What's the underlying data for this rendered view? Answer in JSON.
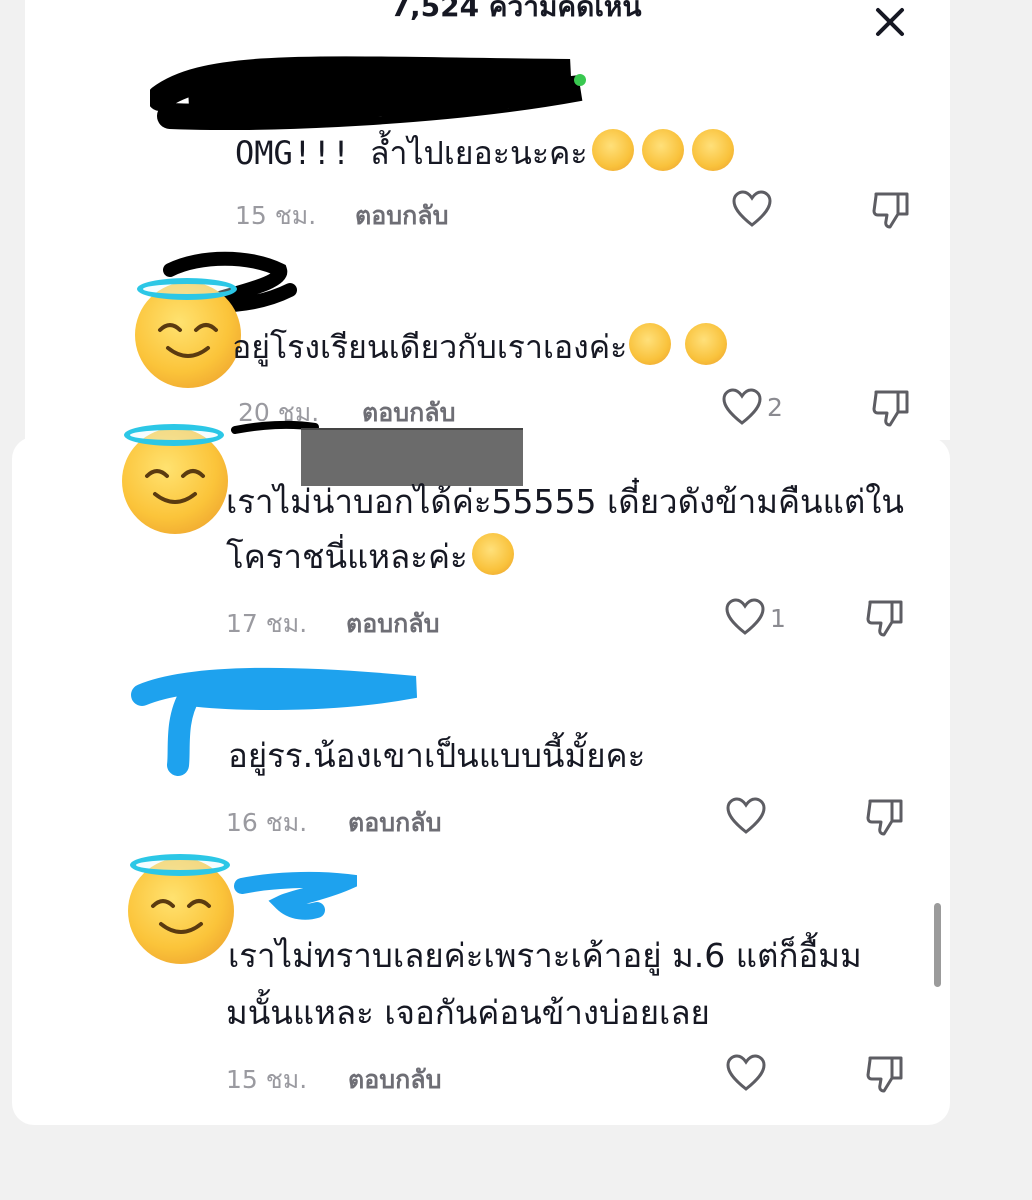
{
  "header": {
    "title": "7,524 ความคิดเห็น"
  },
  "reply_label": "ตอบกลับ",
  "comments": [
    {
      "text": "OMG!!! ล้ำไปเยอะนะคะ",
      "time": "15 ชม.",
      "likes": ""
    },
    {
      "text": "อยู่โรงเรียนเดียวกับเราเองค่ะ",
      "time": "20 ชม.",
      "likes": "2"
    },
    {
      "text_line1": "เราไม่น่าบอกได้ค่ะ55555 เดี๋ยวดังข้ามคืนแต่ใน",
      "text_line2": "โคราชนี่แหละค่ะ",
      "time": "17 ชม.",
      "likes": "1"
    },
    {
      "text": "อยู่รร.น้องเขาเป็นแบบนี้มั้ยคะ",
      "time": "16 ชม.",
      "likes": ""
    },
    {
      "text_line1": "เราไม่ทราบเลยค่ะเพราะเค้าอยู่ ม.6 แต่ก็อื้มม",
      "text_line2": "มนั้นแหละ เจอกันค่อนข้างบ่อยเลย",
      "time": "15 ชม.",
      "likes": ""
    }
  ],
  "icons": {
    "close": "close-icon",
    "like": "heart-outline-icon",
    "dislike": "thumbs-down-outline-icon"
  },
  "colors": {
    "redaction_black": "#000000",
    "redaction_blue": "#1ea2ee",
    "redaction_gray": "#6b6b6b",
    "halo": "#2cc7e6"
  }
}
